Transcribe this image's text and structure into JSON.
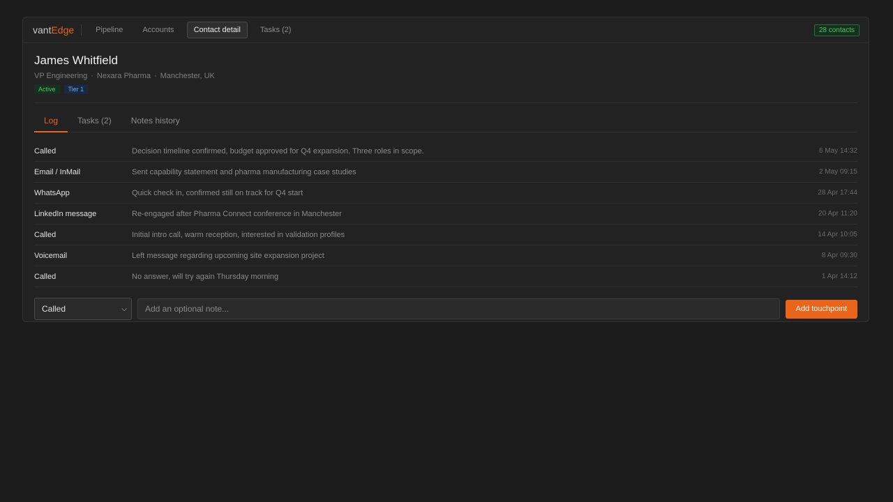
{
  "app": {
    "name_part1": "vant",
    "name_part2": "Edge"
  },
  "nav": {
    "items": [
      {
        "label": "Pipeline"
      },
      {
        "label": "Accounts"
      },
      {
        "label": "Contact detail"
      },
      {
        "label": "Tasks (2)"
      }
    ],
    "active_index": 2,
    "count_badge": "28 contacts"
  },
  "contact": {
    "name": "James Whitfield",
    "title": "VP Engineering",
    "company": "Nexara Pharma",
    "location": "Manchester, UK",
    "separator": "·",
    "tags": [
      {
        "label": "Active"
      },
      {
        "label": "Tier 1"
      }
    ]
  },
  "tabs": [
    {
      "label": "Log"
    },
    {
      "label": "Tasks (2)"
    },
    {
      "label": "Notes history"
    }
  ],
  "active_tab": "Log",
  "log": [
    {
      "type": "Called",
      "note": "Decision timeline confirmed, budget approved for Q4 expansion. Three roles in scope.",
      "time": "6 May 14:32"
    },
    {
      "type": "Email / InMail",
      "note": "Sent capability statement and pharma manufacturing case studies",
      "time": "2 May 09:15"
    },
    {
      "type": "WhatsApp",
      "note": "Quick check in, confirmed still on track for Q4 start",
      "time": "28 Apr 17:44"
    },
    {
      "type": "LinkedIn message",
      "note": "Re-engaged after Pharma Connect conference in Manchester",
      "time": "20 Apr 11:20"
    },
    {
      "type": "Called",
      "note": "Initial intro call, warm reception, interested in validation profiles",
      "time": "14 Apr 10:05"
    },
    {
      "type": "Voicemail",
      "note": "Left message regarding upcoming site expansion project",
      "time": "8 Apr 09:30"
    },
    {
      "type": "Called",
      "note": "No answer, will try again Thursday morning",
      "time": "1 Apr 14:12"
    }
  ],
  "composer": {
    "type_selected": "Called",
    "note_placeholder": "Add an optional note...",
    "add_label": "Add touchpoint"
  },
  "colors": {
    "accent": "#e8651a",
    "background": "#1b1b1b",
    "card": "#222222",
    "success": "#4cc46a",
    "info": "#6ea8e6"
  },
  "icons": {
    "select_chevron": "chevron-down-icon"
  }
}
